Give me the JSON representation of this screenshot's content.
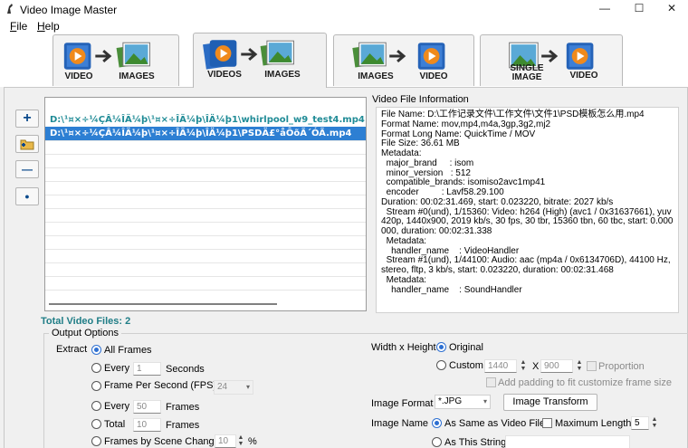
{
  "window": {
    "title": "Video Image Master",
    "controls": {
      "minimize": "—",
      "maximize": "☐",
      "close": "✕"
    }
  },
  "menu": {
    "items": [
      {
        "label": "File",
        "mnemonic": "F",
        "rest": "ile"
      },
      {
        "label": "Help",
        "mnemonic": "H",
        "rest": "elp"
      }
    ]
  },
  "tabs": [
    {
      "labels": [
        "VIDEO",
        "IMAGES"
      ],
      "active": false
    },
    {
      "labels": [
        "VIDEOS",
        "IMAGES"
      ],
      "active": true
    },
    {
      "labels": [
        "IMAGES",
        "VIDEO"
      ],
      "active": false
    },
    {
      "labels": [
        "SINGLE IMAGE",
        "VIDEO"
      ],
      "active": false
    }
  ],
  "sidebar_buttons": {
    "add": "+",
    "remove": "—",
    "dot": "●"
  },
  "files": [
    "D:\\¹¤×÷¼ÇÂ¼ÎÄ¼þ\\¹¤×÷ÎÄ¼þ\\ÎÄ¼þ1\\whirlpool_w9_test4.mp4",
    "D:\\¹¤×÷¼ÇÂ¼ÎÄ¼þ\\¹¤×÷ÎÄ¼þ\\ÎÄ¼þ1\\PSDÄ£°åÔõÃ´ÓÃ.mp4"
  ],
  "info": {
    "heading": "Video File Information",
    "lines": [
      "File Name: D:\\工作记录文件\\工作文件\\文件1\\PSD模板怎么用.mp4",
      "Format Name: mov,mp4,m4a,3gp,3g2,mj2",
      "Format Long Name: QuickTime / MOV",
      "File Size: 36.61 MB",
      "Metadata:",
      "  major_brand     : isom",
      "  minor_version   : 512",
      "  compatible_brands: isomiso2avc1mp41",
      "  encoder         : Lavf58.29.100",
      "Duration: 00:02:31.469, start: 0.023220, bitrate: 2027 kb/s",
      "  Stream #0(und), 1/15360: Video: h264 (High) (avc1 / 0x31637661), yuv420p, 1440x900, 2019 kb/s, 30 fps, 30 tbr, 15360 tbn, 60 tbc, start: 0.000000, duration: 00:02:31.338",
      "  Metadata:",
      "    handler_name    : VideoHandler",
      "  Stream #1(und), 1/44100: Audio: aac (mp4a / 0x6134706D), 44100 Hz, stereo, fltp, 3 kb/s, start: 0.023220, duration: 00:02:31.468",
      "  Metadata:",
      "    handler_name    : SoundHandler"
    ]
  },
  "total_files": "Total Video Files: 2",
  "output_options": {
    "group_label": "Output Options",
    "extract_label": "Extract",
    "all_frames": "All Frames",
    "every_label": "Every",
    "every_seconds_value": "1",
    "seconds_label": "Seconds",
    "fps_label": "Frame Per Second (FPS)",
    "fps_value": "24",
    "every_frames_value": "50",
    "frames_label": "Frames",
    "total_label": "Total",
    "total_value": "10",
    "frames_label2": "Frames",
    "scene_label": "Frames by Scene Change",
    "scene_value": "10",
    "percent": "%"
  },
  "size_options": {
    "label": "Width x Height",
    "original": "Original",
    "custom": "Custom",
    "width": "1440",
    "x": "X",
    "height": "900",
    "proportion": "Proportion",
    "padding": "Add padding to fit customize frame size"
  },
  "format_options": {
    "label": "Image Format",
    "value": "*.JPG",
    "transform_button": "Image Transform"
  },
  "name_options": {
    "label": "Image Name",
    "same_as_video": "As Same as Video File",
    "max_length_label": "Maximum Length",
    "max_length_value": "5",
    "as_this_string": "As This String",
    "string_value": ""
  }
}
